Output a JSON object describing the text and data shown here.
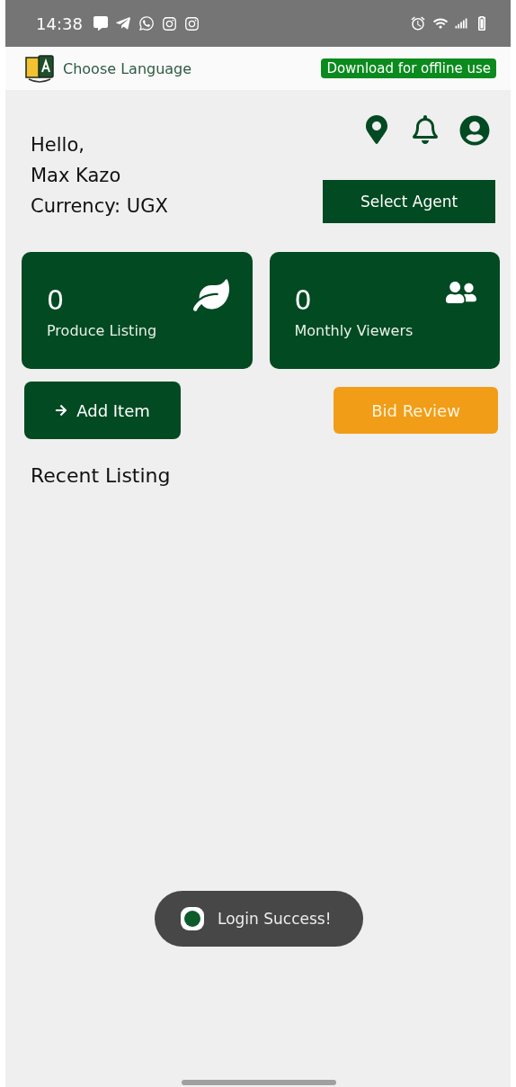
{
  "status_bar": {
    "time": "14:38"
  },
  "header": {
    "language_label": "Choose Language",
    "download_label": "Download for offline use"
  },
  "greeting": {
    "lines": [
      "Hello,",
      "Max Kazo",
      "Currency: UGX"
    ]
  },
  "select_agent": "Select Agent",
  "stats": [
    {
      "kind": "leaf",
      "value": "0",
      "label": "Produce Listing"
    },
    {
      "kind": "people",
      "value": "0",
      "label": "Monthly Viewers"
    }
  ],
  "actions": {
    "add_item": "Add Item",
    "bid_review": "Bid Review"
  },
  "section_title": "Recent Listing",
  "toast": {
    "message": "Login Success!"
  }
}
